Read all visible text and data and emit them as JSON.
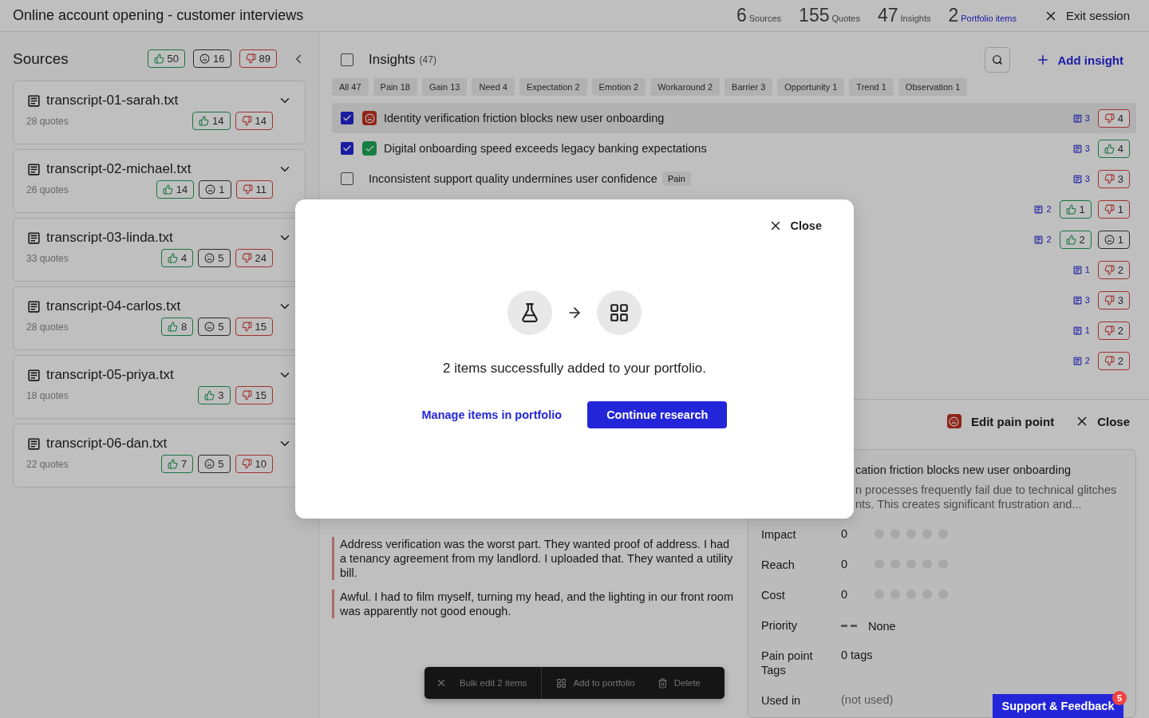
{
  "title": "Online account opening - customer interviews",
  "stats": [
    {
      "value": "6",
      "label": "Sources",
      "kind": "plain"
    },
    {
      "value": "155",
      "label": "Quotes",
      "kind": "plain"
    },
    {
      "value": "47",
      "label": "Insights",
      "kind": "plain"
    },
    {
      "value": "2",
      "label": "Portfolio items",
      "kind": "link"
    }
  ],
  "exit": "Exit session",
  "sources": {
    "title": "Sources",
    "totals": [
      {
        "kind": "gain",
        "count": "50"
      },
      {
        "kind": "neutral",
        "count": "16"
      },
      {
        "kind": "pain",
        "count": "89"
      }
    ],
    "items": [
      {
        "name": "transcript-01-sarah.txt",
        "quotes": "28 quotes",
        "badges": [
          {
            "kind": "gain",
            "count": "14"
          },
          {
            "kind": "pain",
            "count": "14"
          }
        ]
      },
      {
        "name": "transcript-02-michael.txt",
        "quotes": "26 quotes",
        "badges": [
          {
            "kind": "gain",
            "count": "14"
          },
          {
            "kind": "neutral",
            "count": "1"
          },
          {
            "kind": "pain",
            "count": "11"
          }
        ]
      },
      {
        "name": "transcript-03-linda.txt",
        "quotes": "33 quotes",
        "badges": [
          {
            "kind": "gain",
            "count": "4"
          },
          {
            "kind": "neutral",
            "count": "5"
          },
          {
            "kind": "pain",
            "count": "24"
          }
        ]
      },
      {
        "name": "transcript-04-carlos.txt",
        "quotes": "28 quotes",
        "badges": [
          {
            "kind": "gain",
            "count": "8"
          },
          {
            "kind": "neutral",
            "count": "5"
          },
          {
            "kind": "pain",
            "count": "15"
          }
        ]
      },
      {
        "name": "transcript-05-priya.txt",
        "quotes": "18 quotes",
        "badges": [
          {
            "kind": "gain",
            "count": "3"
          },
          {
            "kind": "pain",
            "count": "15"
          }
        ]
      },
      {
        "name": "transcript-06-dan.txt",
        "quotes": "22 quotes",
        "badges": [
          {
            "kind": "gain",
            "count": "7"
          },
          {
            "kind": "neutral",
            "count": "5"
          },
          {
            "kind": "pain",
            "count": "10"
          }
        ]
      }
    ]
  },
  "insights": {
    "title": "Insights",
    "count": "(47)",
    "checked": false,
    "add": "Add insight",
    "filters": [
      {
        "label": "All",
        "count": "47"
      },
      {
        "label": "Pain",
        "count": "18"
      },
      {
        "label": "Gain",
        "count": "13"
      },
      {
        "label": "Need",
        "count": "4"
      },
      {
        "label": "Expectation",
        "count": "2"
      },
      {
        "label": "Emotion",
        "count": "2"
      },
      {
        "label": "Workaround",
        "count": "2"
      },
      {
        "label": "Barrier",
        "count": "3"
      },
      {
        "label": "Opportunity",
        "count": "1"
      },
      {
        "label": "Trend",
        "count": "1"
      },
      {
        "label": "Observation",
        "count": "1"
      }
    ],
    "rows": [
      {
        "selected": true,
        "checked": true,
        "kind": "pain",
        "title": "Identity verification friction blocks new user onboarding",
        "quotes": "3",
        "badges": [
          {
            "kind": "pain",
            "count": "4"
          }
        ]
      },
      {
        "selected": false,
        "checked": true,
        "kind": "gain",
        "title": "Digital onboarding speed exceeds legacy banking expectations",
        "quotes": "3",
        "badges": [
          {
            "kind": "gain",
            "count": "4"
          }
        ]
      },
      {
        "selected": false,
        "checked": false,
        "title": "Inconsistent support quality undermines user confidence",
        "tag": "Pain",
        "quotes": "3",
        "badges": [
          {
            "kind": "pain",
            "count": "3"
          }
        ]
      },
      {
        "selected": false,
        "quotes": "2",
        "badges": [
          {
            "kind": "gain",
            "count": "1"
          },
          {
            "kind": "pain",
            "count": "1"
          }
        ]
      },
      {
        "selected": false,
        "quotes": "2",
        "badges": [
          {
            "kind": "gain",
            "count": "2"
          },
          {
            "kind": "neutral",
            "count": "1"
          }
        ]
      },
      {
        "selected": false,
        "quotes": "1",
        "badges": [
          {
            "kind": "pain",
            "count": "2"
          }
        ]
      },
      {
        "selected": false,
        "quotes": "3",
        "badges": [
          {
            "kind": "pain",
            "count": "3"
          }
        ]
      },
      {
        "selected": false,
        "quotes": "1",
        "badges": [
          {
            "kind": "pain",
            "count": "2"
          }
        ]
      },
      {
        "selected": false,
        "quotes": "2",
        "badges": [
          {
            "kind": "pain",
            "count": "2"
          }
        ]
      }
    ]
  },
  "quotes": [
    {
      "kind": "pain",
      "text": "Address verification was the worst part. They wanted proof of address. I had a tenancy agreement from my landlord. I uploaded that. They wanted a utility bill."
    },
    {
      "kind": "pain",
      "text": "Awful. I had to film myself, turning my head, and the lighting in our front room was apparently not good enough."
    }
  ],
  "detail": {
    "kind": "pain",
    "heading": "Edit pain point",
    "close": "Close",
    "title": "cation friction blocks new user onboarding",
    "description": [
      "n processes frequently fail due to technical glitches",
      "nts. This creates significant frustration and..."
    ],
    "scores": [
      {
        "label": "Impact",
        "value": "0"
      },
      {
        "label": "Reach",
        "value": "0"
      },
      {
        "label": "Cost",
        "value": "0"
      }
    ],
    "priority": {
      "label": "Priority",
      "value": "None"
    },
    "fields": [
      {
        "label": "Pain point Tags",
        "value": "0 tags",
        "muted": false
      },
      {
        "label": "Used in",
        "value": "(not used)",
        "muted": true
      }
    ]
  },
  "bulk": {
    "label": "Bulk edit 2 items",
    "add": "Add to portfolio",
    "delete": "Delete"
  },
  "modal": {
    "close": "Close",
    "message": "2 items successfully added to your portfolio.",
    "link": "Manage items in portfolio",
    "primary": "Continue research"
  },
  "support": {
    "label": "Support & Feedback",
    "count": "5"
  }
}
